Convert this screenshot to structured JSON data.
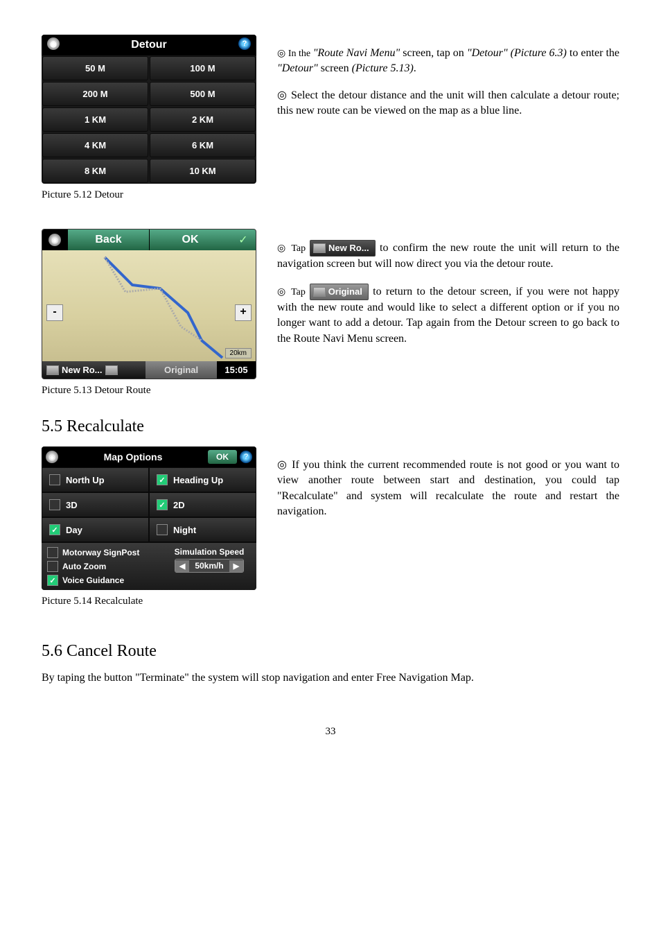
{
  "detour_widget": {
    "title": "Detour",
    "cells": [
      "50 M",
      "100 M",
      "200 M",
      "500 M",
      "1 KM",
      "2 KM",
      "4 KM",
      "6 KM",
      "8 KM",
      "10 KM"
    ]
  },
  "caption_512": "Picture 5.12 Detour",
  "para_detour_1a": "◎ In the ",
  "para_detour_1b": "\"Route Navi Menu\"",
  "para_detour_1c": " screen, tap on ",
  "para_detour_1d": "\"Detour\" (Picture 6.3)",
  "para_detour_1e": " to enter the ",
  "para_detour_1f": "\"Detour\"",
  "para_detour_1g": " screen ",
  "para_detour_1h": "(Picture 5.13)",
  "para_detour_1i": ".",
  "para_detour_2": "◎ Select the detour distance and the unit will then calculate a detour route; this new route can be viewed on the map as a blue line.",
  "route_widget": {
    "back": "Back",
    "ok": "OK",
    "minus": "-",
    "plus": "+",
    "scale": "20km",
    "newro": "New Ro...",
    "original": "Original",
    "time": "15:05"
  },
  "caption_513": "Picture 5.13 Detour Route",
  "tap_prefix": "◎ Tap ",
  "inline_newro": "New Ro...",
  "para_newro_tail": " to confirm the new route the unit will return to the navigation screen but will now direct you via the detour route.",
  "inline_original": "Original",
  "para_original_tail": " to return to the detour screen, if you were not happy with the new route and would like to select a different option or if you no longer want to add a detour. Tap again from the Detour screen to go back to the Route Navi Menu screen.",
  "h_55": "5.5 Recalculate",
  "mapopt": {
    "title": "Map Options",
    "ok": "OK",
    "north_up": "North Up",
    "heading_up": "Heading Up",
    "three_d": "3D",
    "two_d": "2D",
    "day": "Day",
    "night": "Night",
    "motorway": "Motorway SignPost",
    "auto_zoom": "Auto Zoom",
    "voice": "Voice Guidance",
    "sim_label": "Simulation Speed",
    "sim_value": "50km/h"
  },
  "caption_514": "Picture 5.14 Recalculate",
  "para_recalc": "◎ If you think the current recommended route is not good or you want to view another route between start and destination, you could tap \"Recalculate\" and system will recalculate the route and restart the navigation.",
  "h_56": "5.6 Cancel Route",
  "para_cancel": "By taping the button \"Terminate\" the system will stop navigation and enter Free Navigation Map.",
  "page_num": "33"
}
